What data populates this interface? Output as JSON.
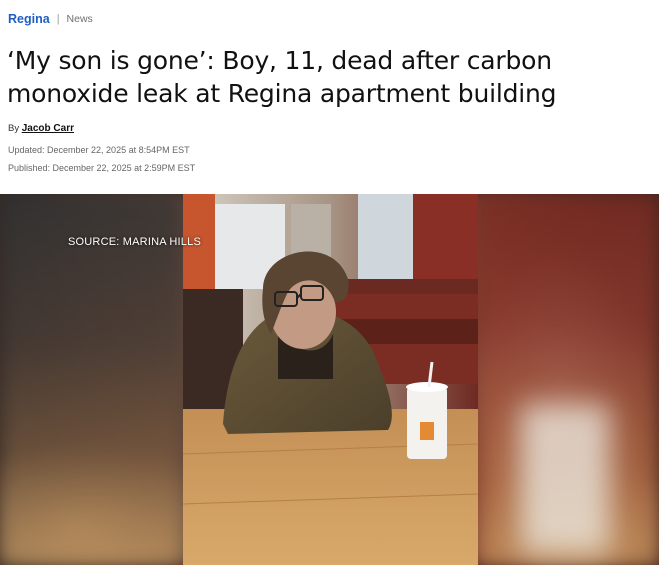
{
  "breadcrumb": {
    "section": "Regina",
    "separator": "|",
    "subsection": "News"
  },
  "headline": "‘My son is gone’: Boy, 11, dead after carbon monoxide leak at Regina apartment building",
  "byline": {
    "prefix": "By",
    "author": "Jacob Carr"
  },
  "timestamps": {
    "updated": "Updated: December 22, 2025 at 8:54PM EST",
    "published": "Published: December 22, 2025 at 2:59PM EST"
  },
  "photo": {
    "caption": "SOURCE: MARINA HILLS"
  }
}
